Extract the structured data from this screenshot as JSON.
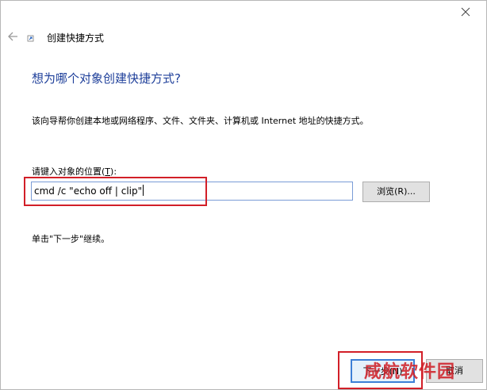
{
  "window": {
    "title": "创建快捷方式",
    "back_icon": "back-arrow-icon",
    "close_icon": "close-icon"
  },
  "main": {
    "heading": "想为哪个对象创建快捷方式?",
    "description": "该向导帮你创建本地或网络程序、文件、文件夹、计算机或 Internet 地址的快捷方式。",
    "location_label_prefix": "请键入对象的位置(",
    "location_label_accel": "T",
    "location_label_suffix": "):",
    "location_value": "cmd /c \"echo off | clip\"",
    "browse_label": "浏览(R)...",
    "hint": "单击\"下一步\"继续。"
  },
  "footer": {
    "next_label": "下一步(N)",
    "cancel_label": "取消"
  },
  "watermark": {
    "text": "咸航软件园"
  },
  "colors": {
    "heading": "#1e3f9a",
    "annotation_red": "#d21f28",
    "focus_blue": "#3c7fd6"
  }
}
